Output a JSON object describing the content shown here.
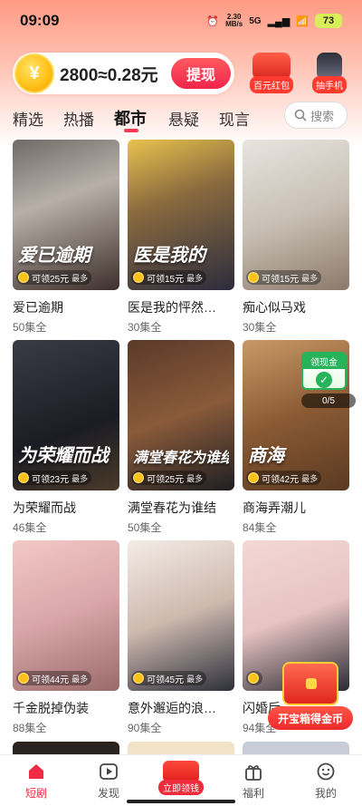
{
  "status_bar": {
    "time": "09:09",
    "net_speed_value": "2.30",
    "net_speed_unit": "MB/s",
    "signal": "5G",
    "battery": "73"
  },
  "header": {
    "coin_text": "2800≈0.28元",
    "withdraw_label": "提现",
    "promo_red_packet_label": "百元红包",
    "promo_phone_label": "抽手机"
  },
  "tabs": {
    "items": [
      "精选",
      "热播",
      "都市",
      "悬疑",
      "现言"
    ],
    "active": "都市",
    "search_placeholder": "搜索"
  },
  "dramas": [
    {
      "title": "爱已逾期",
      "episodes": "50集全",
      "reward": "可领25元",
      "reward_suffix": "最多",
      "poster_text": "爱已逾期"
    },
    {
      "title": "医是我的怦然…",
      "episodes": "30集全",
      "reward": "可领15元",
      "reward_suffix": "最多",
      "poster_text": "医是我的"
    },
    {
      "title": "痴心似马戏",
      "episodes": "30集全",
      "reward": "可领15元",
      "reward_suffix": "最多",
      "poster_text": ""
    },
    {
      "title": "为荣耀而战",
      "episodes": "46集全",
      "reward": "可领23元",
      "reward_suffix": "最多",
      "poster_text": "为荣耀而战"
    },
    {
      "title": "满堂春花为谁结",
      "episodes": "50集全",
      "reward": "可领25元",
      "reward_suffix": "最多",
      "poster_text": "满堂春花为谁结"
    },
    {
      "title": "商海弄潮儿",
      "episodes": "84集全",
      "reward": "可领42元",
      "reward_suffix": "最多",
      "poster_text": "商海"
    },
    {
      "title": "千金脱掉伪装",
      "episodes": "88集全",
      "reward": "可领44元",
      "reward_suffix": "最多",
      "poster_text": ""
    },
    {
      "title": "意外邂逅的浪…",
      "episodes": "90集全",
      "reward": "可领45元",
      "reward_suffix": "最多",
      "poster_text": ""
    },
    {
      "title": "闪婚后",
      "episodes": "94集全",
      "reward": "",
      "reward_suffix": "",
      "poster_text": ""
    }
  ],
  "floating": {
    "reward_widget_title": "领现金",
    "reward_widget_progress": "0/5",
    "treasure_button": "开宝箱得金币"
  },
  "bottom_nav": {
    "items": [
      "短剧",
      "发现",
      "立即领钱",
      "福利",
      "我的"
    ],
    "active": "短剧"
  },
  "colors": {
    "accent": "#ef2c44",
    "coin": "#ffc21a",
    "green": "#27b35a"
  }
}
